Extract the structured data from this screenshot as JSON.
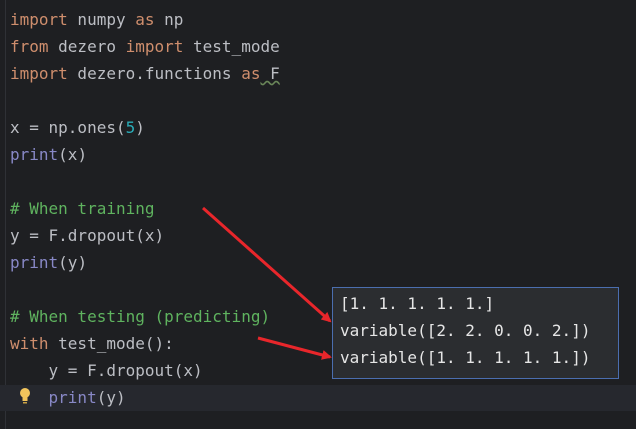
{
  "code_lines": [
    {
      "parts": [
        {
          "t": "import",
          "c": "kw"
        },
        {
          "t": " numpy ",
          "c": ""
        },
        {
          "t": "as",
          "c": "kw"
        },
        {
          "t": " np",
          "c": ""
        }
      ]
    },
    {
      "parts": [
        {
          "t": "from",
          "c": "kw"
        },
        {
          "t": " dezero ",
          "c": ""
        },
        {
          "t": "import",
          "c": "kw"
        },
        {
          "t": " test_mode",
          "c": ""
        }
      ]
    },
    {
      "parts": [
        {
          "t": "import",
          "c": "kw"
        },
        {
          "t": " dezero.functions ",
          "c": ""
        },
        {
          "t": "as",
          "c": "kw"
        },
        {
          "t": " F",
          "c": "ul"
        }
      ]
    },
    {
      "parts": []
    },
    {
      "parts": [
        {
          "t": "x = np.ones(",
          "c": ""
        },
        {
          "t": "5",
          "c": "num"
        },
        {
          "t": ")",
          "c": ""
        }
      ]
    },
    {
      "parts": [
        {
          "t": "print",
          "c": "fn"
        },
        {
          "t": "(x)",
          "c": ""
        }
      ]
    },
    {
      "parts": []
    },
    {
      "parts": [
        {
          "t": "# When training",
          "c": "com"
        }
      ]
    },
    {
      "parts": [
        {
          "t": "y = F.dropout(x)",
          "c": ""
        }
      ]
    },
    {
      "parts": [
        {
          "t": "print",
          "c": "fn"
        },
        {
          "t": "(y)",
          "c": ""
        }
      ]
    },
    {
      "parts": []
    },
    {
      "parts": [
        {
          "t": "# When testing (predicting)",
          "c": "com"
        }
      ]
    },
    {
      "parts": [
        {
          "t": "with",
          "c": "kw"
        },
        {
          "t": " test_mode():",
          "c": ""
        }
      ]
    },
    {
      "parts": [
        {
          "t": "    y = F.dropout(x)",
          "c": ""
        }
      ]
    },
    {
      "parts": [
        {
          "t": "    ",
          "c": ""
        },
        {
          "t": "print",
          "c": "fn"
        },
        {
          "t": "(y)",
          "c": ""
        }
      ]
    }
  ],
  "output_lines": [
    "[1. 1. 1. 1. 1.]",
    "variable([2. 2. 0. 0. 2.])",
    "variable([1. 1. 1. 1. 1.])"
  ],
  "colors": {
    "background": "#1e1f22",
    "keyword": "#cf8e6d",
    "builtin": "#8888c6",
    "number": "#2aacb8",
    "comment": "#5fb35f",
    "arrow": "#e8262b",
    "popup_border": "#4b6eaf"
  },
  "icons": {
    "gutter": "lightbulb-icon"
  }
}
